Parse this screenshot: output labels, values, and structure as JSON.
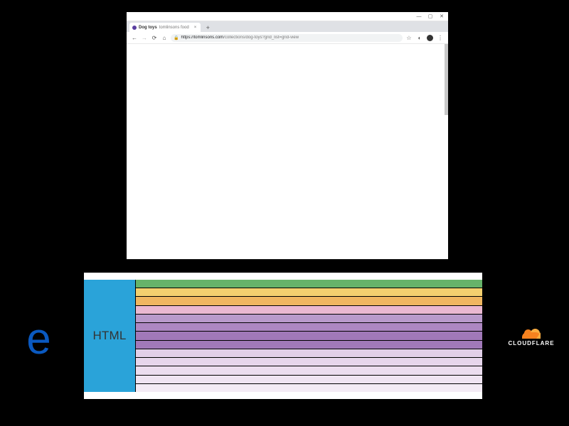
{
  "browser": {
    "window_buttons": {
      "min": "—",
      "max": "▢",
      "close": "✕"
    },
    "tab": {
      "title1": "Dog toys",
      "title2": "tomlinsons food",
      "close": "×"
    },
    "newtab": "+",
    "nav": {
      "back": "←",
      "forward": "→",
      "reload": "⟳",
      "home": "⌂"
    },
    "url": {
      "lock": "🔒",
      "host": "https://tomlinsons.com",
      "path": "/collections/dog-toys?grid_list=grid-view"
    },
    "right": {
      "star": "☆",
      "ext": "◐",
      "menu": "⋮"
    }
  },
  "diagram": {
    "label": "HTML",
    "rows": [
      {
        "color": "#67b36a"
      },
      {
        "color": "#f4d06f"
      },
      {
        "color": "#f0b660"
      },
      {
        "color": "#eab8d1"
      },
      {
        "color": "#b99acb"
      },
      {
        "color": "#ad87c2"
      },
      {
        "color": "#a179b9"
      },
      {
        "color": "#a179b9"
      },
      {
        "color": "#e2cfe8"
      },
      {
        "color": "#e7d6ec"
      },
      {
        "color": "#ecddef"
      },
      {
        "color": "#f0e4f2"
      },
      {
        "color": "#f4ebf5"
      }
    ]
  },
  "edge": {
    "glyph": "e"
  },
  "cloudflare": {
    "wordmark": "CLOUDFLARE"
  }
}
